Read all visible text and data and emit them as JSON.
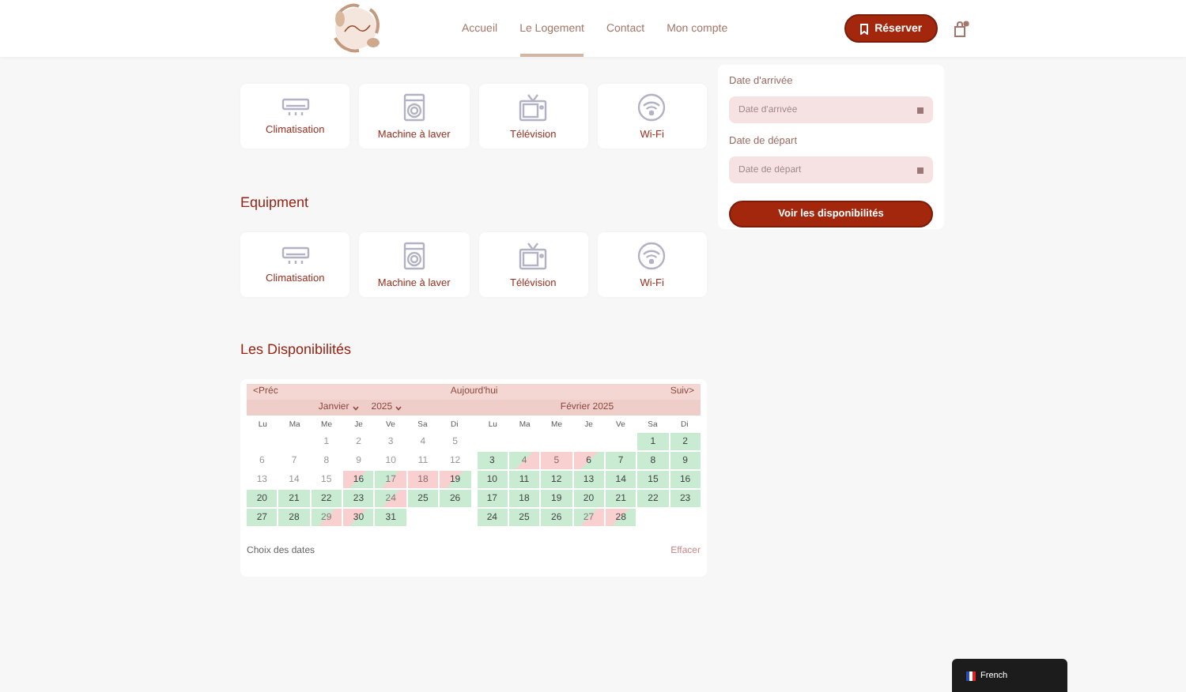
{
  "header": {
    "nav": [
      {
        "label": "Accueil",
        "selected": false
      },
      {
        "label": "Le Logement",
        "selected": true
      },
      {
        "label": "Contact",
        "selected": false
      },
      {
        "label": "Mon compte",
        "selected": false
      }
    ],
    "reserve_button": "Réserver"
  },
  "amenities": [
    {
      "label": "Climatisation",
      "kind": "ac"
    },
    {
      "label": "Machine à laver",
      "kind": "washer"
    },
    {
      "label": "Télévision",
      "kind": "tv"
    },
    {
      "label": "Wi-Fi",
      "kind": "wifi"
    }
  ],
  "equipment": {
    "title": "Equipment",
    "items": [
      {
        "label": "Climatisation",
        "kind": "ac"
      },
      {
        "label": "Machine à laver",
        "kind": "washer"
      },
      {
        "label": "Télévision",
        "kind": "tv"
      },
      {
        "label": "Wi-Fi",
        "kind": "wifi"
      }
    ]
  },
  "availability": {
    "title": "Les Disponibilités",
    "prev": "<Préc",
    "today": "Aujourd'hui",
    "next": "Suiv>",
    "months": [
      {
        "kind": "select",
        "month": "Janvier",
        "year": "2025",
        "weekdays": [
          "Lu",
          "Ma",
          "Me",
          "Je",
          "Ve",
          "Sa",
          "Di"
        ],
        "weeks": [
          [
            {
              "kind": "empty"
            },
            {
              "kind": "empty"
            },
            {
              "d": "1",
              "kind": "past"
            },
            {
              "d": "2",
              "kind": "past"
            },
            {
              "d": "3",
              "kind": "past"
            },
            {
              "d": "4",
              "kind": "past"
            },
            {
              "d": "5",
              "kind": "past"
            }
          ],
          [
            {
              "d": "6",
              "kind": "past"
            },
            {
              "d": "7",
              "kind": "past"
            },
            {
              "d": "8",
              "kind": "past"
            },
            {
              "d": "9",
              "kind": "past"
            },
            {
              "d": "10",
              "kind": "past"
            },
            {
              "d": "11",
              "kind": "past"
            },
            {
              "d": "12",
              "kind": "past"
            }
          ],
          [
            {
              "d": "13",
              "kind": "past"
            },
            {
              "d": "14",
              "kind": "past"
            },
            {
              "d": "15",
              "kind": "past"
            },
            {
              "d": "16",
              "kind": "in"
            },
            {
              "d": "17",
              "kind": "out"
            },
            {
              "d": "18",
              "kind": "booked"
            },
            {
              "d": "19",
              "kind": "in"
            }
          ],
          [
            {
              "d": "20",
              "kind": "free"
            },
            {
              "d": "21",
              "kind": "free"
            },
            {
              "d": "22",
              "kind": "free"
            },
            {
              "d": "23",
              "kind": "free"
            },
            {
              "d": "24",
              "kind": "out"
            },
            {
              "d": "25",
              "kind": "free"
            },
            {
              "d": "26",
              "kind": "free"
            }
          ],
          [
            {
              "d": "27",
              "kind": "free"
            },
            {
              "d": "28",
              "kind": "free"
            },
            {
              "d": "29",
              "kind": "out"
            },
            {
              "d": "30",
              "kind": "in"
            },
            {
              "d": "31",
              "kind": "free"
            },
            {
              "kind": "empty"
            },
            {
              "kind": "empty"
            }
          ]
        ]
      },
      {
        "kind": "text",
        "title": "Février 2025",
        "weekdays": [
          "Lu",
          "Ma",
          "Me",
          "Je",
          "Ve",
          "Sa",
          "Di"
        ],
        "weeks": [
          [
            {
              "kind": "empty"
            },
            {
              "kind": "empty"
            },
            {
              "kind": "empty"
            },
            {
              "kind": "empty"
            },
            {
              "kind": "empty"
            },
            {
              "d": "1",
              "kind": "free"
            },
            {
              "d": "2",
              "kind": "free"
            }
          ],
          [
            {
              "d": "3",
              "kind": "free"
            },
            {
              "d": "4",
              "kind": "out"
            },
            {
              "d": "5",
              "kind": "booked"
            },
            {
              "d": "6",
              "kind": "in"
            },
            {
              "d": "7",
              "kind": "free"
            },
            {
              "d": "8",
              "kind": "free"
            },
            {
              "d": "9",
              "kind": "free"
            }
          ],
          [
            {
              "d": "10",
              "kind": "free"
            },
            {
              "d": "11",
              "kind": "free"
            },
            {
              "d": "12",
              "kind": "free"
            },
            {
              "d": "13",
              "kind": "free"
            },
            {
              "d": "14",
              "kind": "free"
            },
            {
              "d": "15",
              "kind": "free"
            },
            {
              "d": "16",
              "kind": "free"
            }
          ],
          [
            {
              "d": "17",
              "kind": "free"
            },
            {
              "d": "18",
              "kind": "free"
            },
            {
              "d": "19",
              "kind": "free"
            },
            {
              "d": "20",
              "kind": "free"
            },
            {
              "d": "21",
              "kind": "free"
            },
            {
              "d": "22",
              "kind": "free"
            },
            {
              "d": "23",
              "kind": "free"
            }
          ],
          [
            {
              "d": "24",
              "kind": "free"
            },
            {
              "d": "25",
              "kind": "free"
            },
            {
              "d": "26",
              "kind": "free"
            },
            {
              "d": "27",
              "kind": "out"
            },
            {
              "d": "28",
              "kind": "in"
            },
            {
              "kind": "empty"
            },
            {
              "kind": "empty"
            }
          ]
        ]
      }
    ],
    "footer_label": "Choix des dates",
    "clear": "Effacer"
  },
  "booking": {
    "arrival_label": "Date d'arrivée",
    "arrival_placeholder": "Date d'arrivée",
    "departure_label": "Date de départ",
    "departure_placeholder": "Date de départ",
    "button": "Voir les disponibilités"
  },
  "language": {
    "label": "French"
  }
}
